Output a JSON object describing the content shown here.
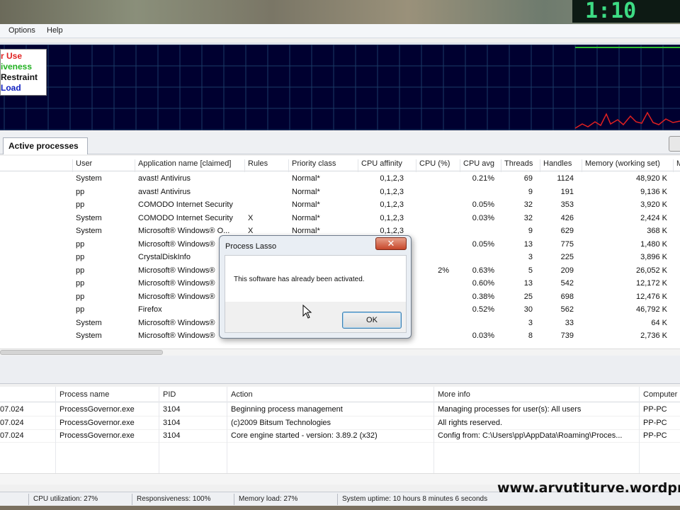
{
  "menu": [
    "Options",
    "Help"
  ],
  "clock": {
    "text": "1:10"
  },
  "legend": [
    {
      "text": "r Use",
      "color": "#e02020"
    },
    {
      "text": "iveness",
      "color": "#20b020"
    },
    {
      "text": "Restraint",
      "color": "#111111"
    },
    {
      "text": "Load",
      "color": "#1020c0"
    }
  ],
  "tabs": {
    "active": "Active processes"
  },
  "process_columns": [
    "User",
    "Application name [claimed]",
    "Rules",
    "Priority class",
    "CPU affinity",
    "CPU (%)",
    "CPU avg",
    "Threads",
    "Handles",
    "Memory (working set)",
    "M"
  ],
  "processes": [
    {
      "user": "System",
      "app": "avast! Antivirus",
      "rules": "",
      "priority": "Normal*",
      "affinity": "0,1,2,3",
      "cpu": "",
      "avg": "0.21%",
      "threads": "69",
      "handles": "1124",
      "memory": "48,920 K"
    },
    {
      "user": "pp",
      "app": "avast! Antivirus",
      "rules": "",
      "priority": "Normal*",
      "affinity": "0,1,2,3",
      "cpu": "",
      "avg": "",
      "threads": "9",
      "handles": "191",
      "memory": "9,136 K"
    },
    {
      "user": "pp",
      "app": "COMODO Internet Security",
      "rules": "",
      "priority": "Normal*",
      "affinity": "0,1,2,3",
      "cpu": "",
      "avg": "0.05%",
      "threads": "32",
      "handles": "353",
      "memory": "3,920 K"
    },
    {
      "user": "System",
      "app": "COMODO Internet Security",
      "rules": "X",
      "priority": "Normal*",
      "affinity": "0,1,2,3",
      "cpu": "",
      "avg": "0.03%",
      "threads": "32",
      "handles": "426",
      "memory": "2,424 K"
    },
    {
      "user": "System",
      "app": "Microsoft® Windows® O...",
      "rules": "X",
      "priority": "Normal*",
      "affinity": "0,1,2,3",
      "cpu": "",
      "avg": "",
      "threads": "9",
      "handles": "629",
      "memory": "368 K"
    },
    {
      "user": "pp",
      "app": "Microsoft® Windows®",
      "rules": "",
      "priority": "Normal*",
      "affinity": "0,1,2,3",
      "cpu": "",
      "avg": "0.05%",
      "threads": "13",
      "handles": "775",
      "memory": "1,480 K"
    },
    {
      "user": "pp",
      "app": "CrystalDiskInfo",
      "rules": "",
      "priority": "",
      "affinity": "",
      "cpu": "",
      "avg": "",
      "threads": "3",
      "handles": "225",
      "memory": "3,896 K"
    },
    {
      "user": "pp",
      "app": "Microsoft® Windows®",
      "rules": "",
      "priority": "",
      "affinity": "",
      "cpu": "2%",
      "avg": "0.63%",
      "threads": "5",
      "handles": "209",
      "memory": "26,052 K"
    },
    {
      "user": "pp",
      "app": "Microsoft® Windows®",
      "rules": "",
      "priority": "",
      "affinity": "",
      "cpu": "",
      "avg": "0.60%",
      "threads": "13",
      "handles": "542",
      "memory": "12,172 K"
    },
    {
      "user": "pp",
      "app": "Microsoft® Windows®",
      "rules": "",
      "priority": "",
      "affinity": "",
      "cpu": "",
      "avg": "0.38%",
      "threads": "25",
      "handles": "698",
      "memory": "12,476 K"
    },
    {
      "user": "pp",
      "app": "Firefox",
      "rules": "",
      "priority": "",
      "affinity": "",
      "cpu": "",
      "avg": "0.52%",
      "threads": "30",
      "handles": "562",
      "memory": "46,792 K"
    },
    {
      "user": "System",
      "app": "Microsoft® Windows®",
      "rules": "",
      "priority": "",
      "affinity": "",
      "cpu": "",
      "avg": "",
      "threads": "3",
      "handles": "33",
      "memory": "64 K"
    },
    {
      "user": "System",
      "app": "Microsoft® Windows®",
      "rules": "",
      "priority": "",
      "affinity": "",
      "cpu": "",
      "avg": "0.03%",
      "threads": "8",
      "handles": "739",
      "memory": "2,736 K"
    }
  ],
  "log_columns": [
    "Process name",
    "PID",
    "Action",
    "More info",
    "Computer"
  ],
  "log_rows": [
    {
      "time": "07.024",
      "process": "ProcessGovernor.exe",
      "pid": "3104",
      "action": "Beginning process management",
      "info": "Managing processes for user(s): All users",
      "computer": "PP-PC"
    },
    {
      "time": "07.024",
      "process": "ProcessGovernor.exe",
      "pid": "3104",
      "action": "(c)2009 Bitsum Technologies",
      "info": "All rights reserved.",
      "computer": "PP-PC"
    },
    {
      "time": "07.024",
      "process": "ProcessGovernor.exe",
      "pid": "3104",
      "action": "Core engine started - version: 3.89.2 (x32)",
      "info": "Config from: C:\\Users\\pp\\AppData\\Roaming\\Proces...",
      "computer": "PP-PC"
    }
  ],
  "status": {
    "cpu": "CPU utilization: 27%",
    "responsiveness": "Responsiveness: 100%",
    "memory": "Memory load: 27%",
    "uptime": "System uptime: 10 hours 8 minutes 6 seconds"
  },
  "watermark": "www.arvutiturve.wordpr",
  "dialog": {
    "title": "Process Lasso",
    "close_glyph": "✕",
    "message": "This software has already been activated.",
    "ok_label": "OK"
  }
}
